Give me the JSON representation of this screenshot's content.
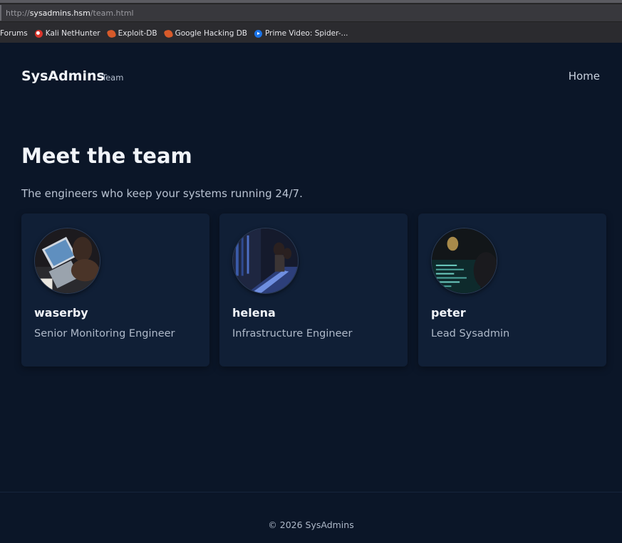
{
  "browser": {
    "url_protocol": "http://",
    "url_host": "sysadmins.hsm",
    "url_path": "/team.html",
    "bookmarks": [
      {
        "label": "Forums",
        "icon": "none"
      },
      {
        "label": "Kali NetHunter",
        "icon": "kali-dragon-icon"
      },
      {
        "label": "Exploit-DB",
        "icon": "exploit-db-icon"
      },
      {
        "label": "Google Hacking DB",
        "icon": "ghdb-icon"
      },
      {
        "label": "Prime Video: Spider-...",
        "icon": "prime-video-icon"
      }
    ]
  },
  "nav": {
    "brand": "SysAdmins",
    "brand_sub": "Team",
    "home_link": "Home"
  },
  "hero": {
    "title": "Meet the team",
    "subtitle": "The engineers who keep your systems running 24/7."
  },
  "team": [
    {
      "name": "waserby",
      "role": "Senior Monitoring Engineer",
      "avatar": "photo-laptop-desk"
    },
    {
      "name": "helena",
      "role": "Infrastructure Engineer",
      "avatar": "photo-server-room"
    },
    {
      "name": "peter",
      "role": "Lead Sysadmin",
      "avatar": "photo-terminal-screen"
    }
  ],
  "footer": {
    "copyright": "© 2026 SysAdmins"
  },
  "colors": {
    "page_bg": "#0b1628",
    "card_bg": "#101f36",
    "heading": "#f1f4f9",
    "muted": "#aeb9c9"
  }
}
